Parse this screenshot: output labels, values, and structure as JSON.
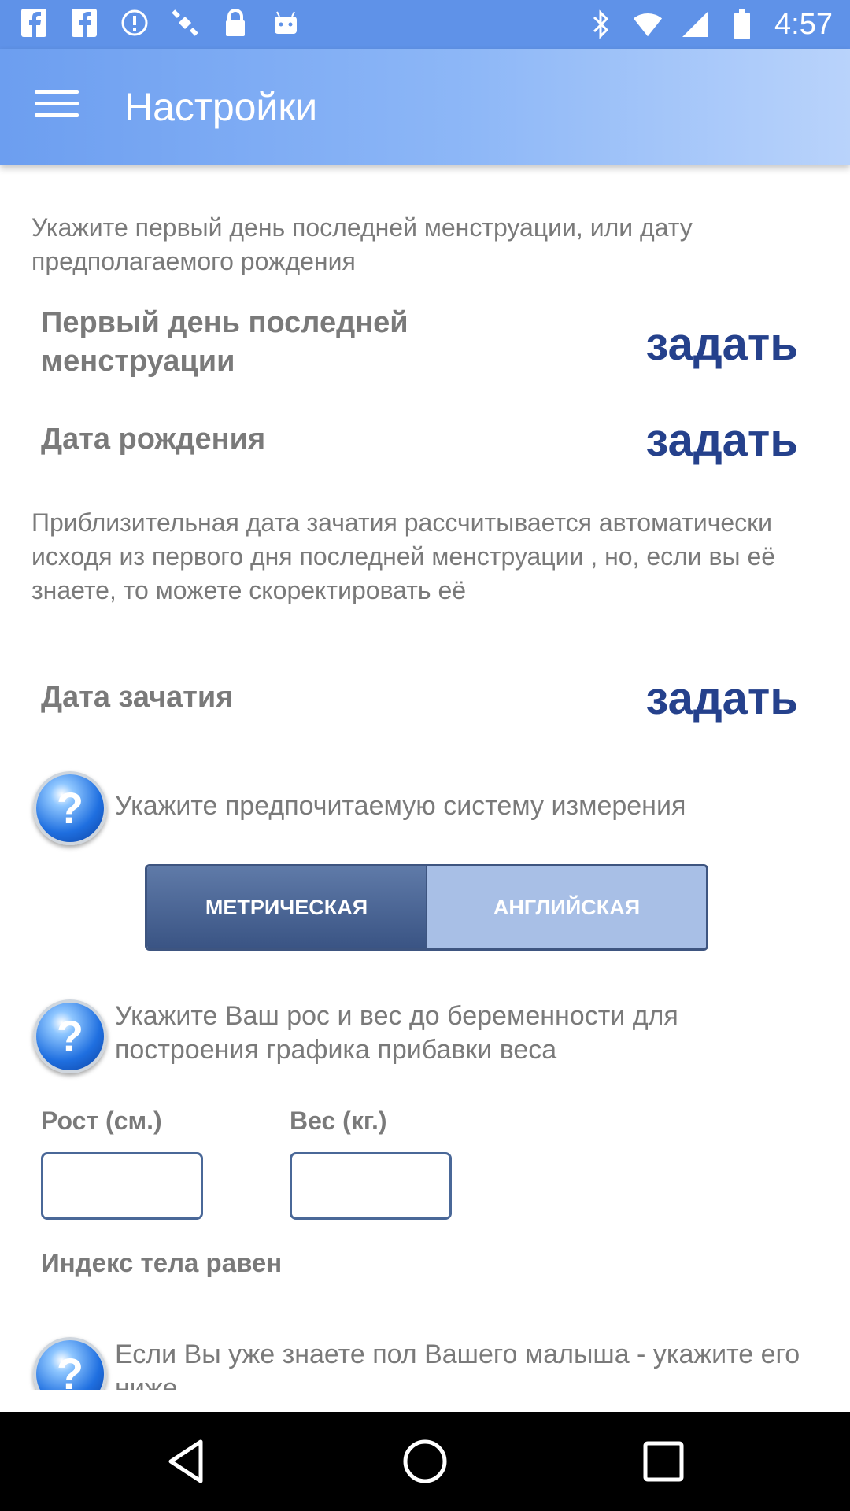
{
  "status_bar": {
    "time": "4:57",
    "left_icons": [
      "facebook-icon",
      "facebook-icon",
      "alert-icon",
      "satellite-icon",
      "lock-icon",
      "android-icon"
    ],
    "right_icons": [
      "bluetooth-icon",
      "wifi-icon",
      "signal-icon",
      "battery-icon"
    ]
  },
  "app_bar": {
    "title": "Настройки",
    "menu_icon": "hamburger-menu-icon",
    "color": "#6c9ef0"
  },
  "content": {
    "hint_lmp": "Укажите первый день последней менструации, или дату предполагаемого рождения",
    "lmp_label": "Первый день последней менструации",
    "set_label": "задать",
    "birth_date_label": "Дата рождения",
    "hint_conception": "Приблизительная дата зачатия рассчитывается автоматически исходя из первого дня последней менструации , но, если вы её знаете, то можете скоректировать её",
    "conception_label": "Дата зачатия",
    "units_hint": "Укажите предпочитаемую систему измерения",
    "units": {
      "options": [
        "МЕТРИЧЕСКАЯ",
        "АНГЛИЙСКАЯ"
      ],
      "selected": "МЕТРИЧЕСКАЯ"
    },
    "height_weight_hint": "Укажите Ваш рос и вес до беременности для построения графика прибавки веса",
    "height_label": "Рост (см.)",
    "height_value": "",
    "weight_label": "Вес (кг.)",
    "weight_value": "",
    "bmi_label": "Индекс тела равен",
    "gender_hint": "Если Вы уже знаете пол Вашего малыша - укажите его ниже",
    "help_icon": "help-question-icon",
    "accent_color": "#25418c"
  },
  "nav_bar": {
    "buttons": [
      "back-icon",
      "home-icon",
      "recent-apps-icon"
    ]
  }
}
